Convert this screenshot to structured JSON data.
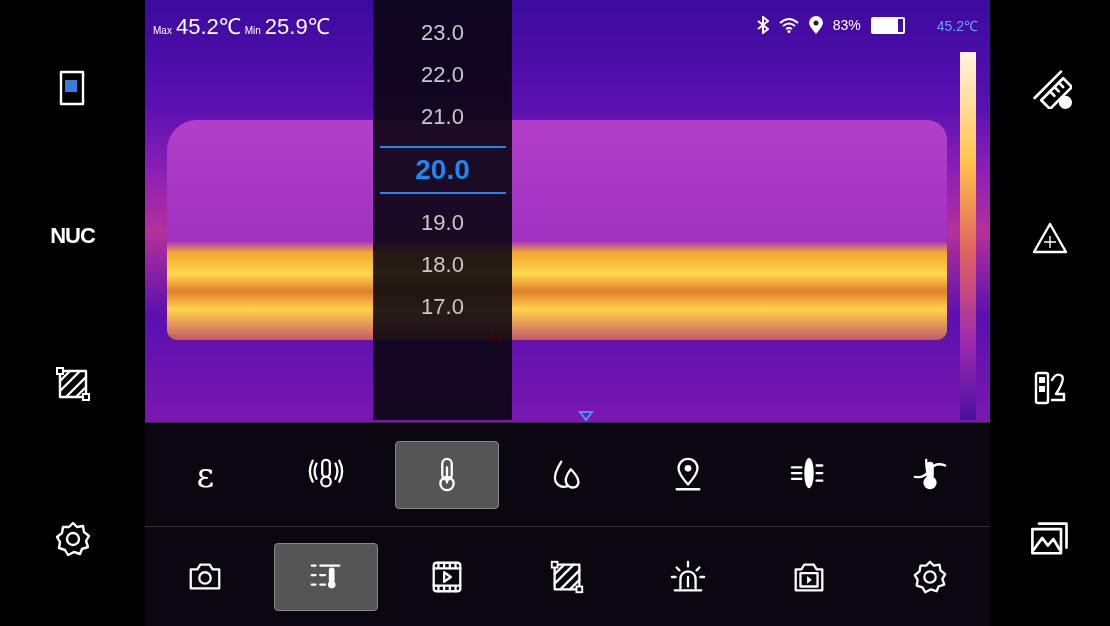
{
  "status_bar": {
    "max_label": "Max",
    "max_value": "45.2℃",
    "min_label": "Min",
    "min_value": "25.9℃",
    "battery_percent": "83%",
    "scale_max": "45.2℃"
  },
  "left_sidebar": {
    "nuc_label": "NUC"
  },
  "picker": {
    "values": [
      {
        "label": "23.0",
        "selected": false
      },
      {
        "label": "22.0",
        "selected": false
      },
      {
        "label": "21.0",
        "selected": false
      },
      {
        "label": "20.0",
        "selected": true
      },
      {
        "label": "19.0",
        "selected": false
      },
      {
        "label": "18.0",
        "selected": false
      },
      {
        "label": "17.0",
        "selected": false
      }
    ]
  },
  "tools": [
    {
      "kind": "glyph",
      "label": "ε",
      "selected": false
    },
    {
      "kind": "alarm",
      "selected": false
    },
    {
      "kind": "thermometer",
      "selected": true
    },
    {
      "kind": "humidity",
      "selected": false
    },
    {
      "kind": "location",
      "selected": false
    },
    {
      "kind": "lens",
      "selected": false
    },
    {
      "kind": "probe",
      "selected": false
    }
  ],
  "bottom_bar": [
    {
      "kind": "camera",
      "selected": false
    },
    {
      "kind": "table",
      "selected": true
    },
    {
      "kind": "video",
      "selected": false
    },
    {
      "kind": "area",
      "selected": false
    },
    {
      "kind": "siren",
      "selected": false
    },
    {
      "kind": "playback",
      "selected": false
    },
    {
      "kind": "gear",
      "selected": false
    }
  ]
}
